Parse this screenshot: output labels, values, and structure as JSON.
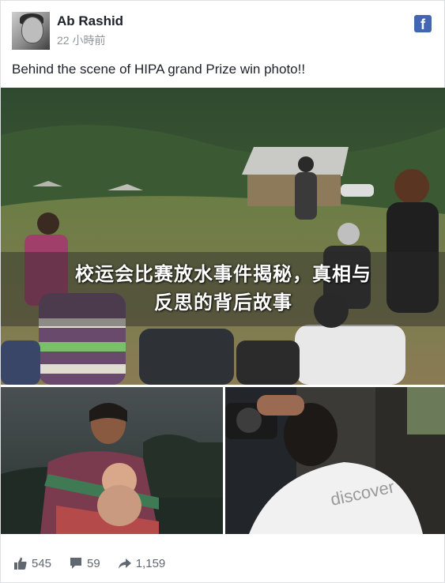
{
  "post": {
    "author": "Ab Rashid",
    "timestamp": "22 小時前",
    "caption": "Behind the scene of HIPA grand Prize win photo!!",
    "platform_badge": "f",
    "overlay_title_lines": [
      "校运会比赛放水事件揭秘，真相与",
      "反思的背后故事"
    ],
    "photo_tshirt_text": "discover"
  },
  "actions": {
    "likes": "545",
    "comments": "59",
    "shares": "1,159"
  },
  "colors": {
    "facebook_blue": "#4267b2",
    "text_primary": "#1d2129",
    "text_secondary": "#90949c",
    "action_grey": "#606770"
  },
  "icons": {
    "like": "thumbs-up-icon",
    "comment": "comment-icon",
    "share": "share-arrow-icon",
    "platform": "facebook-icon"
  }
}
